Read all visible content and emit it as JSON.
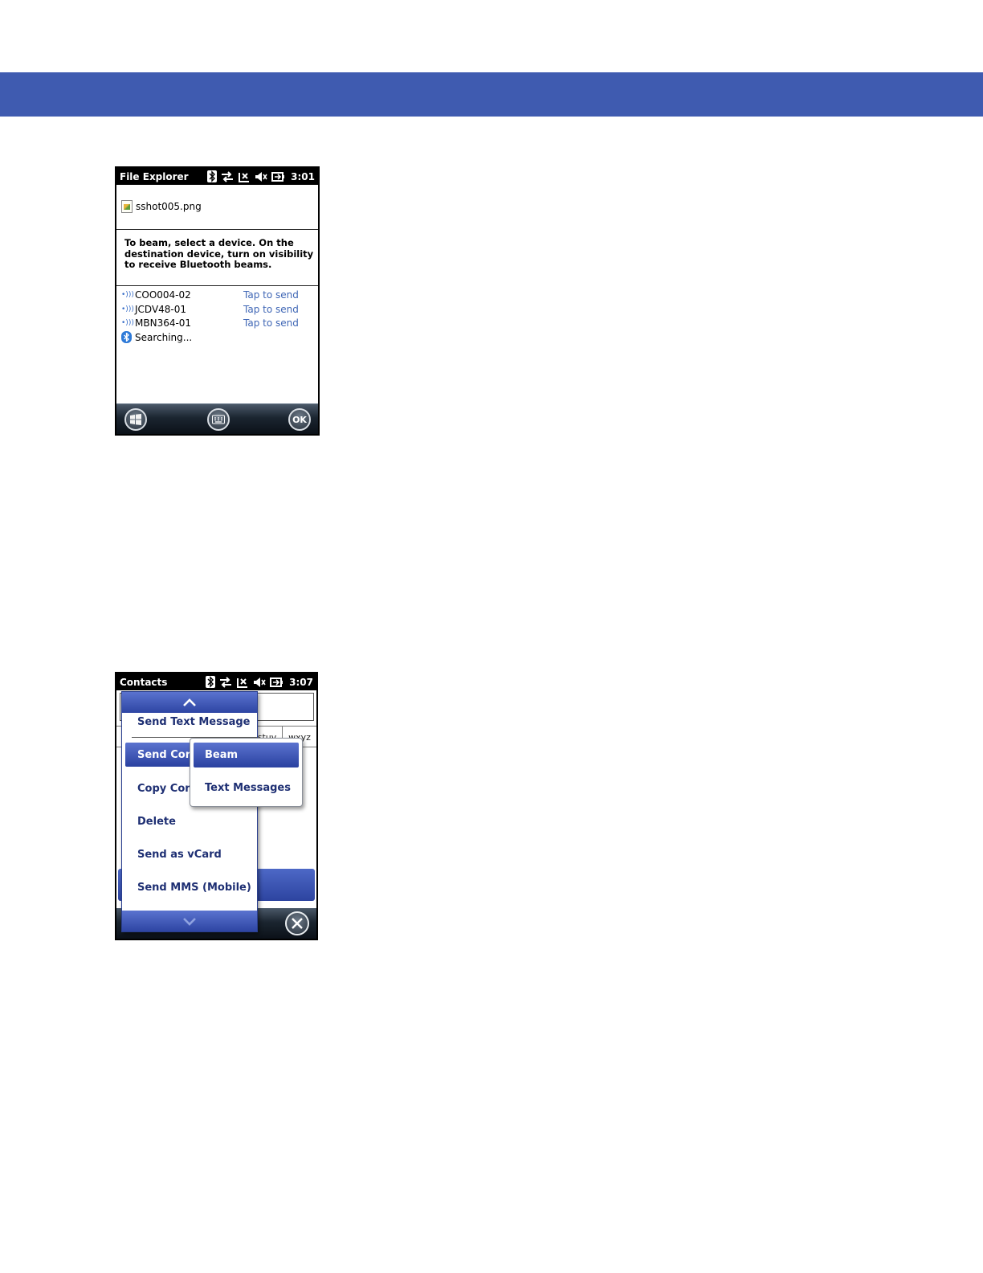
{
  "colors": {
    "header_band": "#3f5bb0",
    "menu_accent": "#2e45a3",
    "link_blue": "#3f66b5"
  },
  "screen1": {
    "app_title": "File Explorer",
    "clock": "3:01",
    "file_name": "sshot005.png",
    "instructions": "To beam, select a device. On the destination device, turn on visibility to receive Bluetooth beams.",
    "devices": [
      {
        "name": "COO004-02",
        "action": "Tap to send"
      },
      {
        "name": "JCDV48-01",
        "action": "Tap to send"
      },
      {
        "name": "MBN364-01",
        "action": "Tap to send"
      }
    ],
    "searching": "Searching...",
    "ok_label": "OK"
  },
  "screen2": {
    "app_title": "Contacts",
    "clock": "3:07",
    "keypad_labels": [
      "stuv",
      "wxyz"
    ],
    "menu_items": [
      "Send Text Message",
      "Send Cont",
      "Copy Cont",
      "Delete",
      "Send as vCard",
      "Send MMS (Mobile)"
    ],
    "submenu_items": [
      "Beam",
      "Text Messages"
    ]
  }
}
